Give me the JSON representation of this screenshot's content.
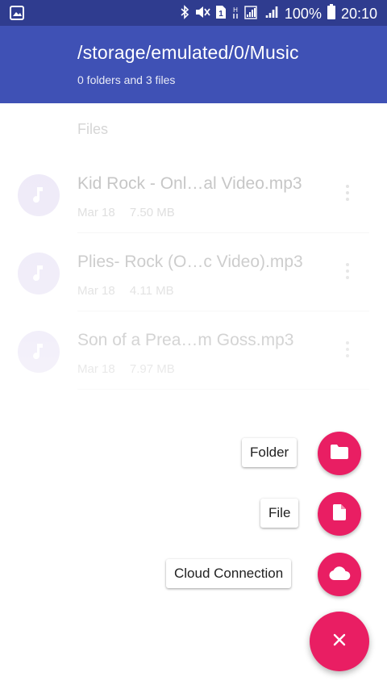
{
  "status_bar": {
    "battery": "100%",
    "time": "20:10",
    "icons": [
      "gallery-icon",
      "bluetooth-icon",
      "mute-icon",
      "sim-icon",
      "network-h-icon",
      "signal-icon",
      "battery-icon"
    ]
  },
  "app_bar": {
    "title": "/storage/emulated/0/Music",
    "subtitle": "0 folders and 3 files"
  },
  "list": {
    "section_header": "Files",
    "files": [
      {
        "name": "Kid Rock - Onl…al Video.mp3",
        "date": "Mar 18",
        "size": "7.50 MB",
        "icon": "music-note-icon"
      },
      {
        "name": "Plies- Rock (O…c Video).mp3",
        "date": "Mar 18",
        "size": "4.11 MB",
        "icon": "music-note-icon"
      },
      {
        "name": "Son of a Prea…m Goss.mp3",
        "date": "Mar 18",
        "size": "7.97 MB",
        "icon": "music-note-icon"
      }
    ]
  },
  "fab_menu": {
    "items": [
      {
        "label": "Folder",
        "icon": "folder-icon"
      },
      {
        "label": "File",
        "icon": "file-icon"
      },
      {
        "label": "Cloud Connection",
        "icon": "cloud-icon"
      }
    ],
    "close_icon": "close-icon"
  },
  "colors": {
    "status_bar": "#2f3c8f",
    "app_bar": "#3f51b5",
    "accent": "#e91e63",
    "avatar_bg": "#e3dcf3"
  }
}
